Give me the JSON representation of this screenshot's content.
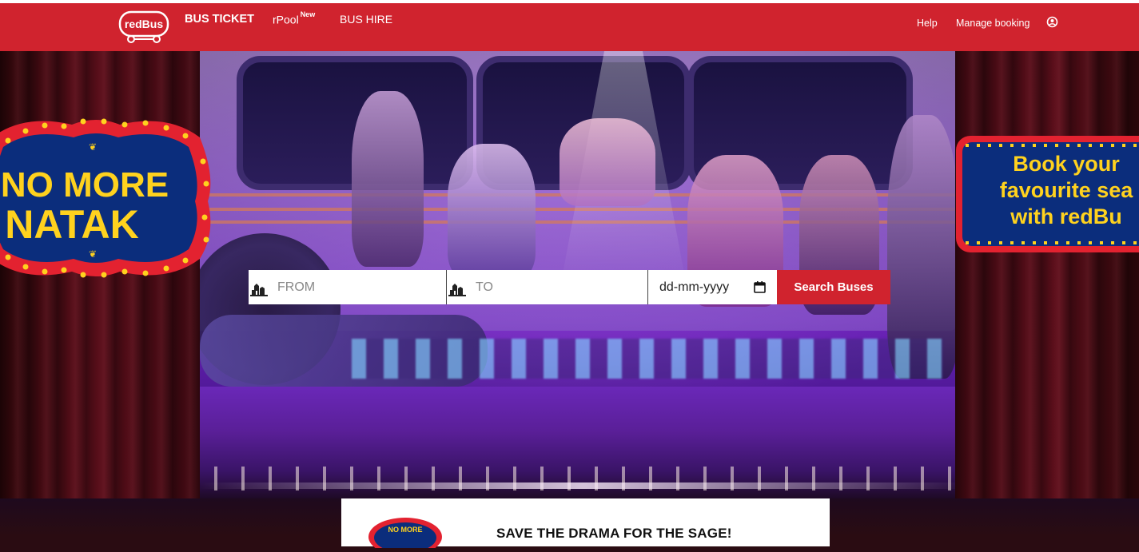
{
  "header": {
    "logo_text": "redBus",
    "nav": {
      "bus_ticket": "BUS TICKET",
      "rpool": "rPool",
      "rpool_badge": "New",
      "bus_hire": "BUS HIRE"
    },
    "right": {
      "help": "Help",
      "manage_booking": "Manage booking"
    },
    "brand_color": "#d0232e"
  },
  "hero": {
    "badge_left": {
      "line1": "NO MORE",
      "line2": "NATAK"
    },
    "badge_right": {
      "line1": "Book your",
      "line2": "favourite sea",
      "line3": "with redBu"
    }
  },
  "search": {
    "from_placeholder": "FROM",
    "to_placeholder": "TO",
    "date_placeholder": "dd-mm-yyyy",
    "button_label": "Search Buses"
  },
  "promo": {
    "logo_text": "NO MORE",
    "headline": "SAVE THE DRAMA FOR THE SAGE!"
  },
  "icons": {
    "from": "city-icon",
    "to": "city-icon",
    "date": "calendar-icon",
    "profile": "profile-icon"
  }
}
